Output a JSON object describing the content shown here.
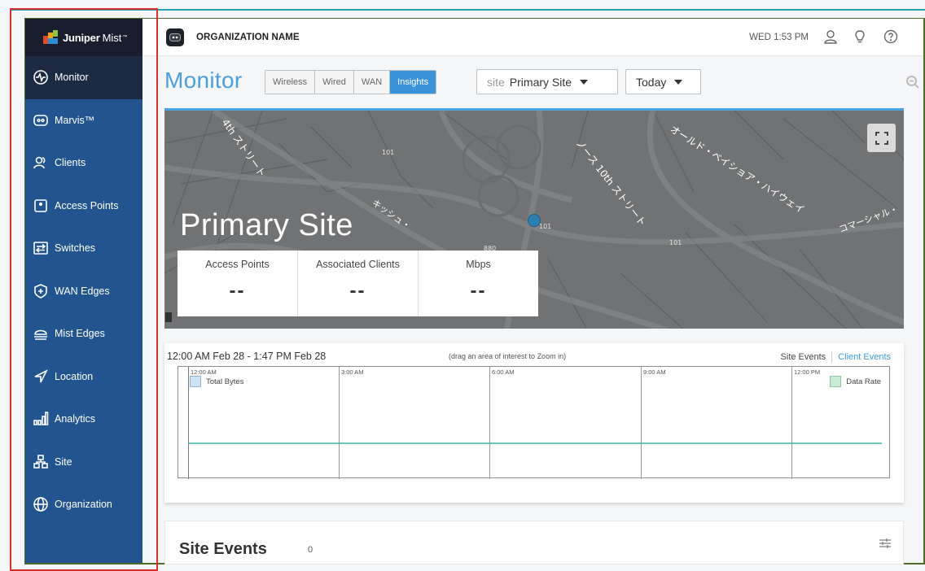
{
  "app": {
    "logo_brand": "Juniper",
    "logo_product": "Mist",
    "logo_tm": "™"
  },
  "sidebar": {
    "items": [
      {
        "label": "Monitor",
        "icon": "monitor-icon",
        "active": true
      },
      {
        "label": "Marvis™",
        "icon": "marvis-icon",
        "active": false
      },
      {
        "label": "Clients",
        "icon": "clients-icon",
        "active": false
      },
      {
        "label": "Access Points",
        "icon": "access-point-icon",
        "active": false
      },
      {
        "label": "Switches",
        "icon": "switch-icon",
        "active": false
      },
      {
        "label": "WAN Edges",
        "icon": "wan-edge-icon",
        "active": false
      },
      {
        "label": "Mist Edges",
        "icon": "mist-edge-icon",
        "active": false
      },
      {
        "label": "Location",
        "icon": "location-icon",
        "active": false
      },
      {
        "label": "Analytics",
        "icon": "analytics-icon",
        "active": false
      },
      {
        "label": "Site",
        "icon": "site-icon",
        "active": false
      },
      {
        "label": "Organization",
        "icon": "organization-icon",
        "active": false
      }
    ]
  },
  "topbar": {
    "org_name": "ORGANIZATION NAME",
    "clock": "WED 1:53 PM",
    "icons": [
      "user-icon",
      "lightbulb-icon",
      "help-icon"
    ]
  },
  "page": {
    "title": "Monitor",
    "tabs": [
      {
        "label": "Wireless",
        "active": false
      },
      {
        "label": "Wired",
        "active": false
      },
      {
        "label": "WAN",
        "active": false
      },
      {
        "label": "Insights",
        "active": true
      }
    ],
    "site_prefix": "site",
    "site_value": "Primary Site",
    "period_value": "Today"
  },
  "map": {
    "site_name": "Primary Site",
    "map_labels": [
      "4th ストリート",
      "101",
      "ノース 10th ストリート",
      "オールド・ベイショア・ハイウェイ",
      "コマーシャル・",
      "キッシュ・",
      "880",
      "101",
      "101"
    ],
    "stats": [
      {
        "label": "Access Points",
        "value": "--"
      },
      {
        "label": "Associated Clients",
        "value": "--"
      },
      {
        "label": "Mbps",
        "value": "--"
      }
    ]
  },
  "timeline": {
    "range": "12:00 AM Feb 28 - 1:47 PM Feb 28",
    "hint": "(drag an area of interest to Zoom in)",
    "site_events_link": "Site Events",
    "client_events_link": "Client Events",
    "ticks": [
      "12:00 AM",
      "3:00 AM",
      "6:00 AM",
      "9:00 AM",
      "12:00 PM"
    ],
    "legend_left": "Total Bytes",
    "legend_right": "Data Rate",
    "colors": {
      "total_bytes": "#cfe3f5",
      "data_rate": "#c9ecd6",
      "line": "#39b39f"
    }
  },
  "events": {
    "title": "Site Events",
    "count": "0"
  }
}
